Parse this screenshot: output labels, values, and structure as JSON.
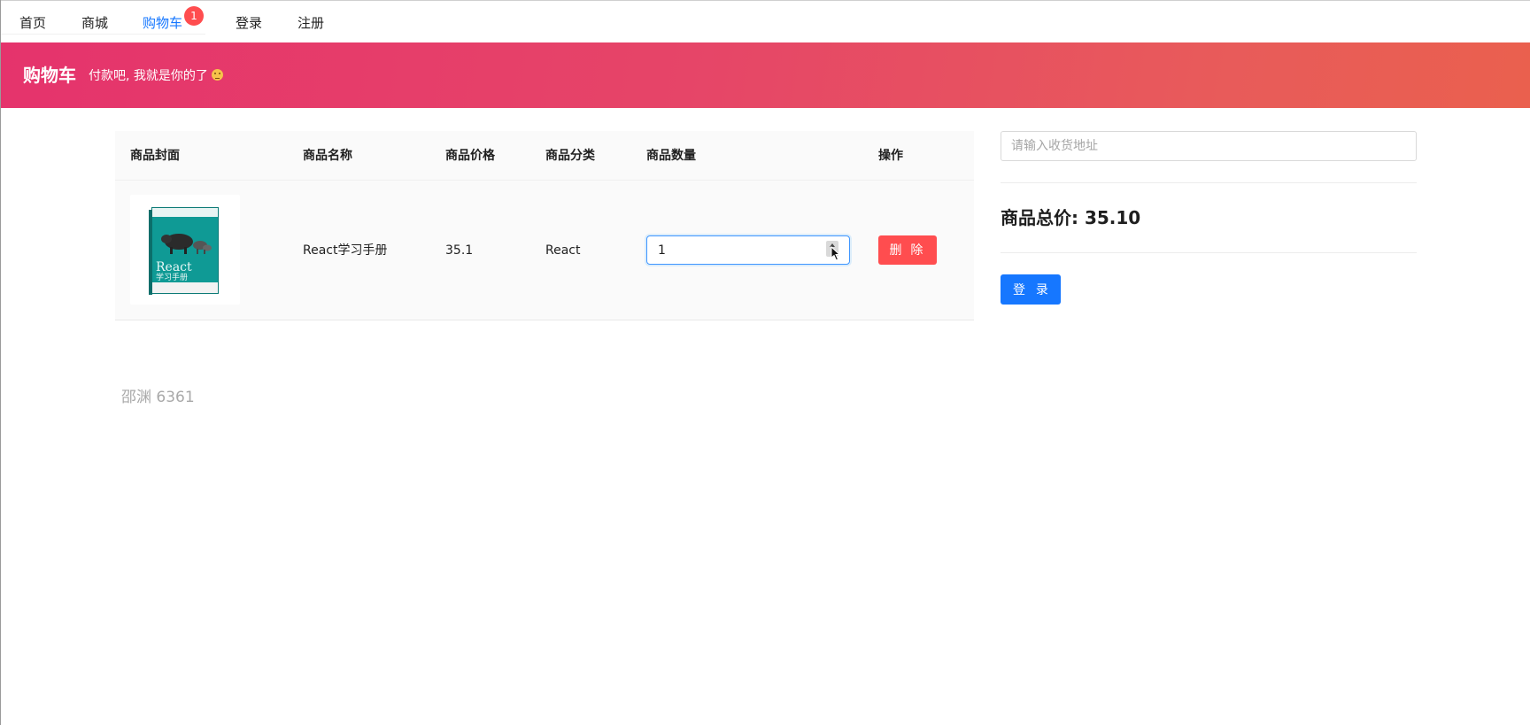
{
  "nav": {
    "items": [
      {
        "label": "首页"
      },
      {
        "label": "商城"
      },
      {
        "label": "购物车",
        "active": true
      },
      {
        "label": "登录"
      },
      {
        "label": "注册"
      }
    ],
    "cart_badge": "1"
  },
  "banner": {
    "title": "购物车",
    "subtitle": "付款吧, 我就是你的了"
  },
  "table": {
    "headers": [
      "商品封面",
      "商品名称",
      "商品价格",
      "商品分类",
      "商品数量",
      "操作"
    ],
    "rows": [
      {
        "cover_title": "React",
        "cover_subtitle": "学习手册",
        "name": "React学习手册",
        "price": "35.1",
        "category": "React",
        "quantity": "1",
        "delete_label": "删 除"
      }
    ]
  },
  "checkout": {
    "address_placeholder": "请输入收货地址",
    "total": "商品总价: 35.10",
    "login_label": "登 录"
  },
  "watermark": "邵渊 6361",
  "colors": {
    "primary": "#1677ff",
    "danger": "#ff4d4f",
    "banner_start": "#e5336c",
    "banner_end": "#ea604e"
  }
}
